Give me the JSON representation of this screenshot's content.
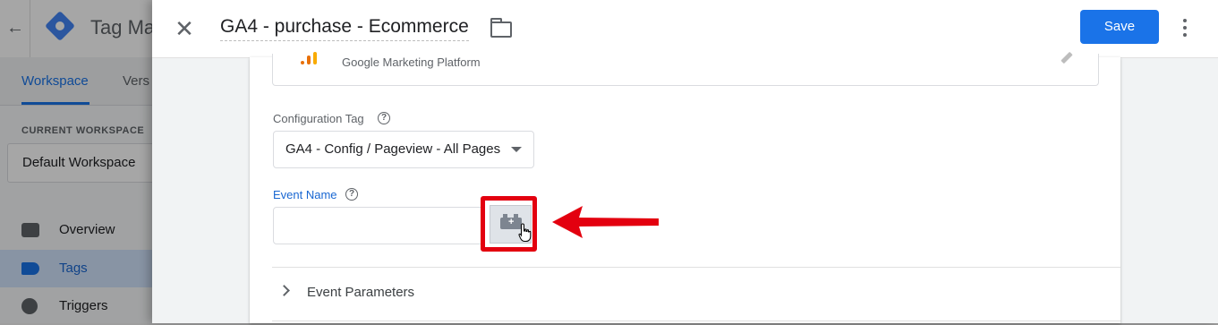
{
  "background_app": {
    "title": "Tag Ma",
    "tabs": [
      {
        "label": "Workspace",
        "active": true
      },
      {
        "label": "Vers",
        "active": false
      }
    ],
    "workspace_label": "CURRENT WORKSPACE",
    "workspace_name": "Default Workspace",
    "nav": [
      {
        "label": "Overview",
        "icon": "folder-icon"
      },
      {
        "label": "Tags",
        "icon": "tag-icon",
        "active": true
      },
      {
        "label": "Triggers",
        "icon": "trigger-icon"
      }
    ]
  },
  "header": {
    "close_icon": "close-icon",
    "tag_name": "GA4 - purchase - Ecommerce",
    "folder_icon": "folder-icon",
    "save_label": "Save",
    "more_icon": "more-vert-icon"
  },
  "tag_type": {
    "subtitle": "Google Marketing Platform",
    "edit_icon": "pencil-icon"
  },
  "configuration_tag": {
    "label": "Configuration Tag",
    "selected": "GA4 - Config / Pageview - All Pages"
  },
  "event_name": {
    "label": "Event Name",
    "value": "",
    "variable_button_icon": "add-variable-icon"
  },
  "sections": {
    "event_parameters": "Event Parameters"
  },
  "colors": {
    "accent": "#1a73e8",
    "highlight": "#e3000f"
  }
}
